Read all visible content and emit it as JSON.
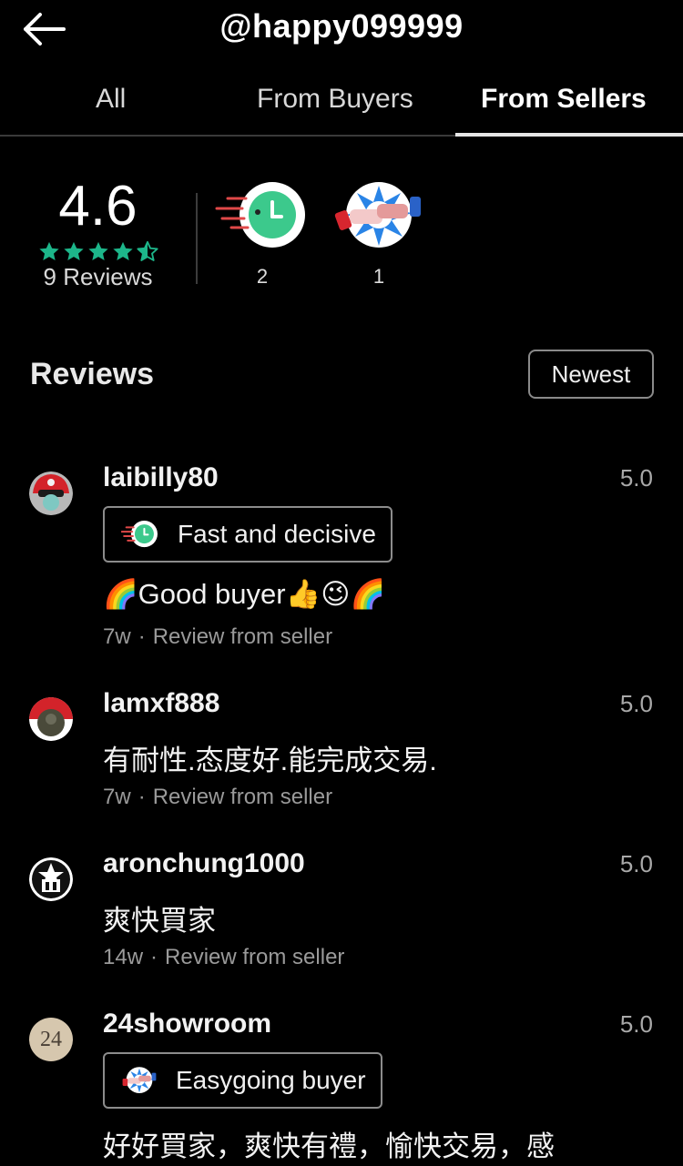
{
  "header": {
    "title": "@happy099999",
    "back_icon": "arrow-left-icon"
  },
  "tabs": [
    {
      "label": "All",
      "active": false
    },
    {
      "label": "From Buyers",
      "active": false
    },
    {
      "label": "From Sellers",
      "active": true
    }
  ],
  "summary": {
    "rating": "4.6",
    "stars_value": 4.6,
    "reviews_label": "9 Reviews",
    "star_color": "#1db68a",
    "badges": [
      {
        "icon": "fast-clock-badge-icon",
        "count": "2"
      },
      {
        "icon": "handshake-badge-icon",
        "count": "1"
      }
    ]
  },
  "reviews_section": {
    "title": "Reviews",
    "sort_label": "Newest"
  },
  "reviews": [
    {
      "username": "laibilly80",
      "score": "5.0",
      "avatar": "red-helmet-avatar",
      "tag": {
        "icon": "fast-clock-badge-icon",
        "label": "Fast and decisive"
      },
      "comment": "🌈Good buyer👍😉🌈",
      "time": "7w",
      "source": "Review from seller"
    },
    {
      "username": "lamxf888",
      "score": "5.0",
      "avatar": "pokeball-avatar",
      "comment": "有耐性.态度好.能完成交易.",
      "time": "7w",
      "source": "Review from seller"
    },
    {
      "username": "aronchung1000",
      "score": "5.0",
      "avatar": "logo-avatar",
      "comment": "爽快買家",
      "time": "14w",
      "source": "Review from seller"
    },
    {
      "username": "24showroom",
      "score": "5.0",
      "avatar": "number-24-avatar",
      "avatar_text": "24",
      "tag": {
        "icon": "handshake-badge-icon",
        "label": "Easygoing buyer"
      },
      "comment": "好好買家，爽快有禮，愉快交易，感",
      "time": "",
      "source": ""
    }
  ]
}
